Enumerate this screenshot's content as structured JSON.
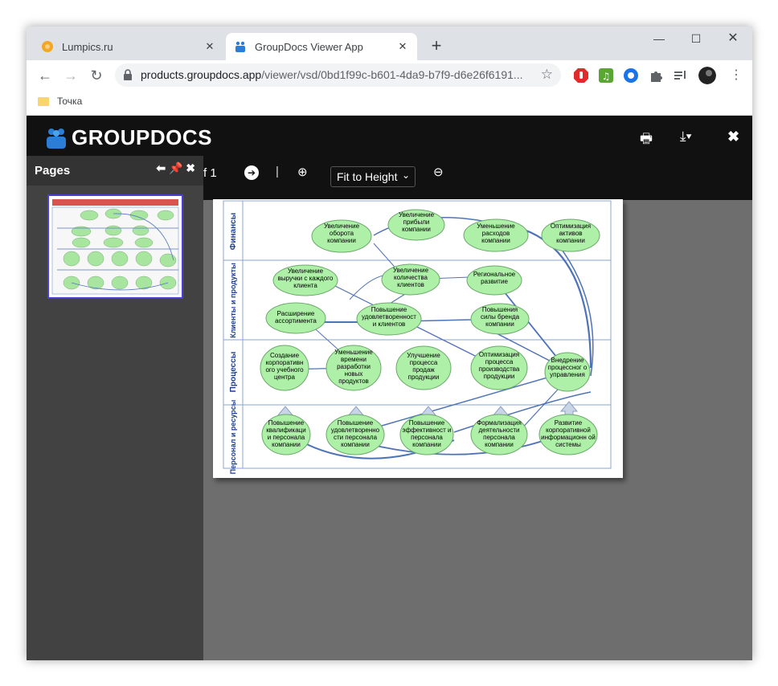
{
  "browser": {
    "tabs": [
      {
        "title": "Lumpics.ru",
        "active": false
      },
      {
        "title": "GroupDocs Viewer App",
        "active": true
      }
    ],
    "url_host": "products.groupdocs.app",
    "url_path": "/viewer/vsd/0bd1f99c-b601-4da9-b7f9-d6e26f6191...",
    "bookmark": "Точка"
  },
  "app": {
    "logo_text": "GROUPDOCS",
    "pages_title": "Pages",
    "page_counter": "f 1",
    "zoom_select": "Fit to Height"
  },
  "diagram": {
    "rows": [
      "Финансы",
      "Клиенты и продукты",
      "Процессы",
      "Персонал и ресурсы"
    ],
    "nodes": [
      {
        "id": "n1",
        "label": "Увеличение оборота компании"
      },
      {
        "id": "n2",
        "label": "Увеличение прибыли компании"
      },
      {
        "id": "n3",
        "label": "Уменьшение расходов компании"
      },
      {
        "id": "n4",
        "label": "Оптимизация активов компании"
      },
      {
        "id": "n5",
        "label": "Увеличение выручки с каждого клиента"
      },
      {
        "id": "n6",
        "label": "Увеличение количества клиентов"
      },
      {
        "id": "n7",
        "label": "Региональное развитие"
      },
      {
        "id": "n8",
        "label": "Расширение ассортимента"
      },
      {
        "id": "n9",
        "label": "Повышение удовлетворенност и клиентов"
      },
      {
        "id": "n10",
        "label": "Повышения силы бренда компании"
      },
      {
        "id": "n11",
        "label": "Создание корпоративн ого учебного центра"
      },
      {
        "id": "n12",
        "label": "Уменьшение времени разработки новых продуктов"
      },
      {
        "id": "n13",
        "label": "Улучшение процесса продаж продукции"
      },
      {
        "id": "n14",
        "label": "Оптимизация процесса производства продукции"
      },
      {
        "id": "n15",
        "label": "Внедрение процессног о управления"
      },
      {
        "id": "n16",
        "label": "Повышение квалификаци и персонала компании"
      },
      {
        "id": "n17",
        "label": "Повышение удовлетворенно сти персонала компании"
      },
      {
        "id": "n18",
        "label": "Повышение эффективност и персонала компании"
      },
      {
        "id": "n19",
        "label": "Формализация деятельности персонала компании"
      },
      {
        "id": "n20",
        "label": "Развитие корпоративной информационн ой системы"
      }
    ]
  }
}
